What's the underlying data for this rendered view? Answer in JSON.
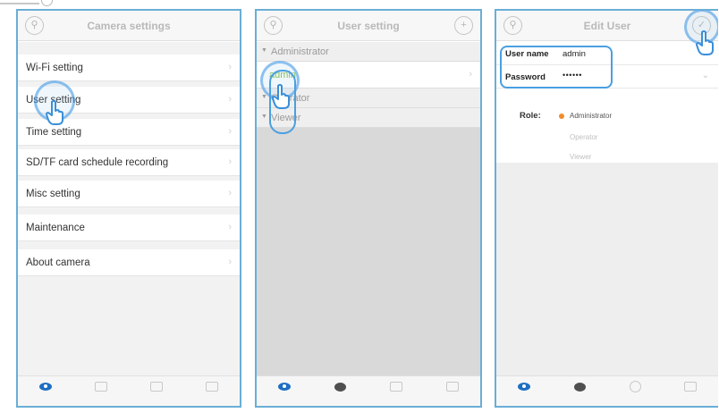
{
  "colors": {
    "frame": "#6aaed6",
    "highlight": "#4a9fe0",
    "active_tab": "#1e6fc2",
    "admin_user_text": "#8bc34a",
    "role_selected_dot": "#f28c28"
  },
  "screen1": {
    "title": "Camera settings",
    "menu": [
      {
        "label": "Wi-Fi setting"
      },
      {
        "label": "User setting"
      },
      {
        "label": "Time setting"
      },
      {
        "label": "SD/TF card schedule recording"
      },
      {
        "label": "Misc setting"
      },
      {
        "label": "Maintenance"
      },
      {
        "label": "About camera"
      }
    ]
  },
  "screen2": {
    "title": "User setting",
    "groups": [
      {
        "label": "Administrator"
      },
      {
        "label": "Operator"
      },
      {
        "label": "Viewer"
      }
    ],
    "admin_user": "admin"
  },
  "screen3": {
    "title": "Edit User",
    "username_label": "User name",
    "username_value": "admin",
    "password_label": "Password",
    "password_value": "••••••",
    "role_label": "Role:",
    "roles": [
      "Administrator",
      "Operator",
      "Viewer"
    ],
    "selected_role": "Administrator"
  },
  "icons": {
    "back": "search-circle-icon",
    "add": "plus-circle-icon",
    "confirm": "check-circle-icon",
    "row_chevron": "chevron-right-icon",
    "password_toggle": "chevron-down-icon",
    "tabs": [
      "camera-eye-icon",
      "message-icon",
      "device-icon",
      "settings-icon"
    ],
    "pointer": "hand-pointer-icon"
  }
}
